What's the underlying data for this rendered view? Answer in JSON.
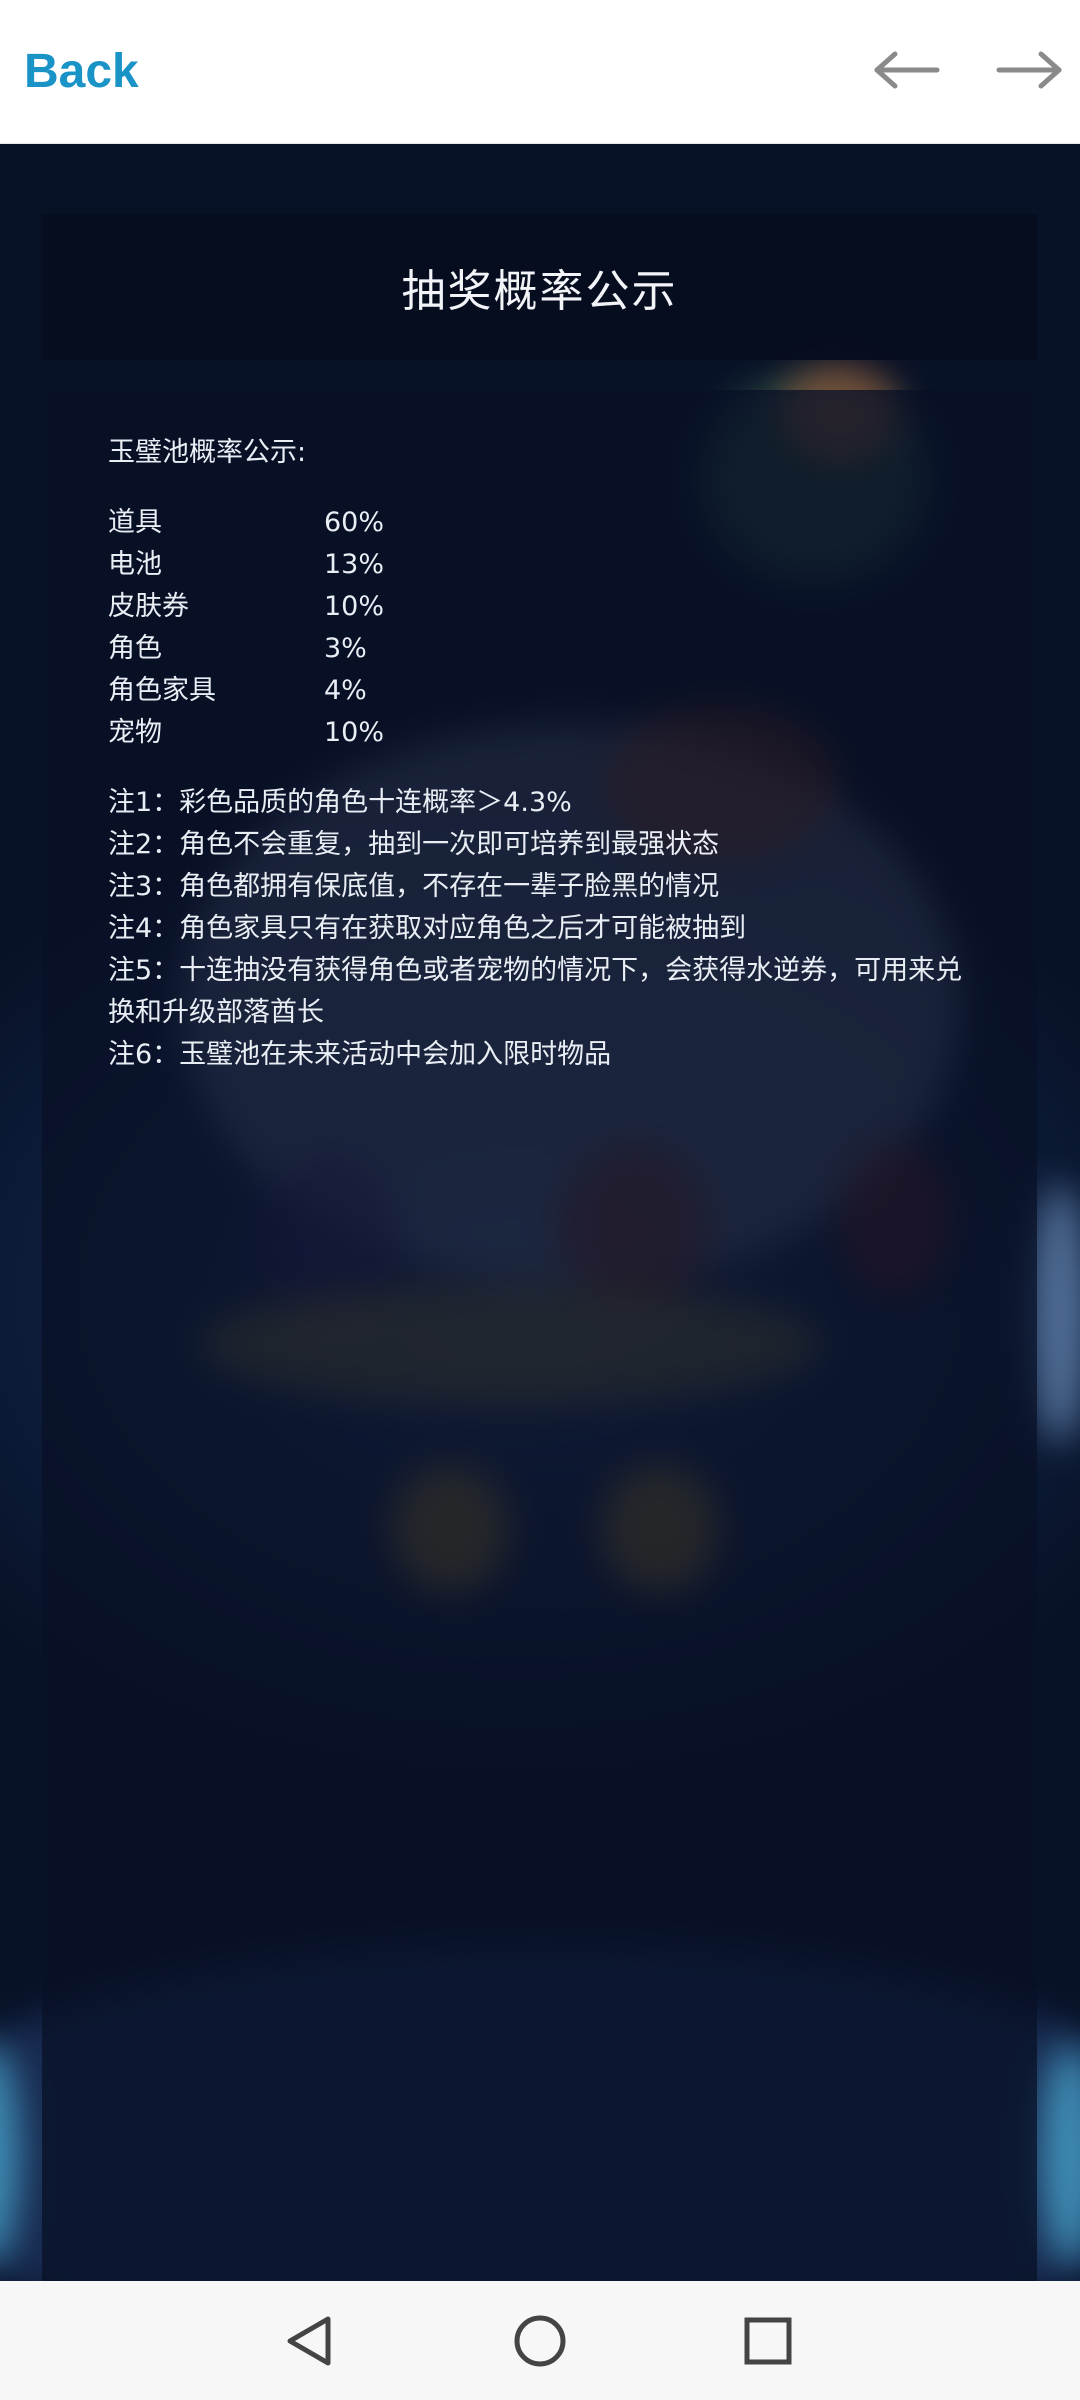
{
  "topbar": {
    "back_label": "Back",
    "prev_icon": "arrow-left-icon",
    "next_icon": "arrow-right-icon"
  },
  "page": {
    "title": "抽奖概率公示",
    "subhead": "玉璧池概率公示:",
    "probabilities": [
      {
        "name": "道具",
        "value": "60%"
      },
      {
        "name": "电池",
        "value": "13%"
      },
      {
        "name": "皮肤券",
        "value": "10%"
      },
      {
        "name": "角色",
        "value": "3%"
      },
      {
        "name": "角色家具",
        "value": "4%"
      },
      {
        "name": "宠物",
        "value": "10%"
      }
    ],
    "notes": [
      "注1：彩色品质的角色十连概率＞4.3%",
      "注2：角色不会重复，抽到一次即可培养到最强状态",
      "注3：角色都拥有保底值，不存在一辈子脸黑的情况",
      "注4：角色家具只有在获取对应角色之后才可能被抽到",
      "注5：十连抽没有获得角色或者宠物的情况下，会获得水逆券，可用来兑换和升级部落酋长",
      "注6：玉璧池在未来活动中会加入限时物品"
    ]
  },
  "system_nav": {
    "back_icon": "triangle-back-icon",
    "home_icon": "circle-home-icon",
    "recents_icon": "square-recents-icon"
  },
  "colors": {
    "accent": "#1a93c7",
    "panel": "#060d1e",
    "text": "#e9edf4"
  }
}
